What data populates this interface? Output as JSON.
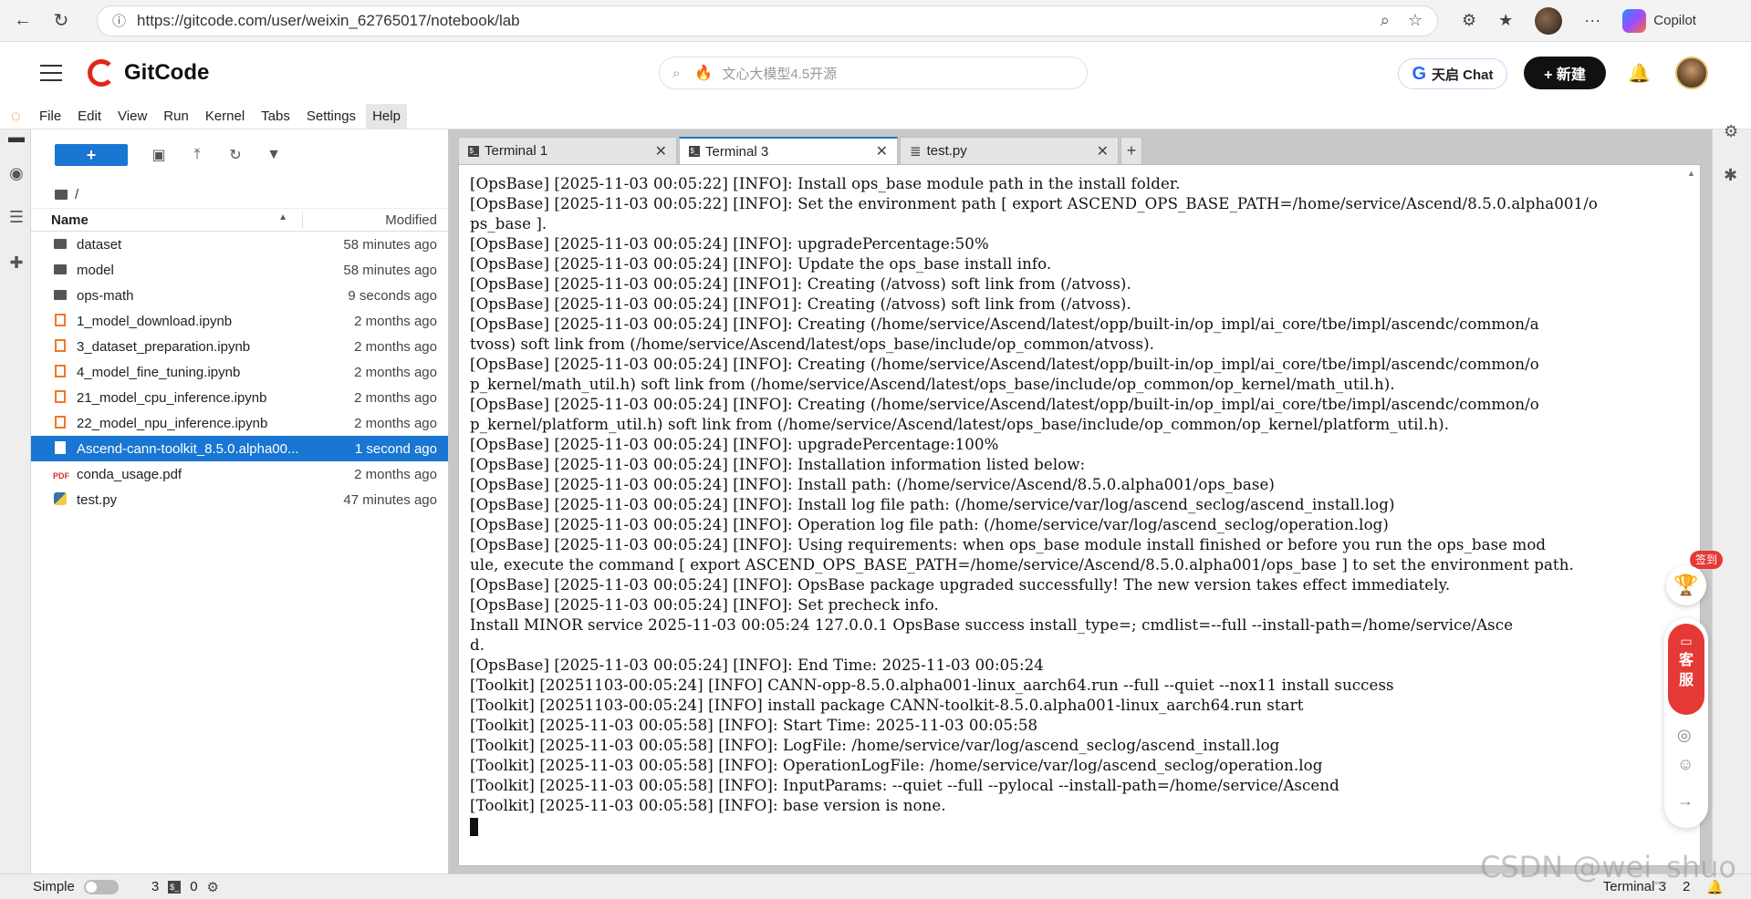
{
  "browser": {
    "url": "https://gitcode.com/user/weixin_62765017/notebook/lab",
    "copilot_label": "Copilot"
  },
  "gitcode": {
    "brand": "GitCode",
    "search_placeholder": "文心大模型4.5开源",
    "chat_label": "天启 Chat",
    "new_label": "+ 新建"
  },
  "menu": [
    "File",
    "Edit",
    "View",
    "Run",
    "Kernel",
    "Tabs",
    "Settings",
    "Help"
  ],
  "filebrowser": {
    "breadcrumb": "/",
    "col_name": "Name",
    "col_modified": "Modified",
    "files": [
      {
        "name": "dataset",
        "modified": "58 minutes ago"
      },
      {
        "name": "model",
        "modified": "58 minutes ago"
      },
      {
        "name": "ops-math",
        "modified": "9 seconds ago"
      },
      {
        "name": "1_model_download.ipynb",
        "modified": "2 months ago"
      },
      {
        "name": "3_dataset_preparation.ipynb",
        "modified": "2 months ago"
      },
      {
        "name": "4_model_fine_tuning.ipynb",
        "modified": "2 months ago"
      },
      {
        "name": "21_model_cpu_inference.ipynb",
        "modified": "2 months ago"
      },
      {
        "name": "22_model_npu_inference.ipynb",
        "modified": "2 months ago"
      },
      {
        "name": "Ascend-cann-toolkit_8.5.0.alpha00...",
        "modified": "1 second ago"
      },
      {
        "name": "conda_usage.pdf",
        "modified": "2 months ago"
      },
      {
        "name": "test.py",
        "modified": "47 minutes ago"
      }
    ]
  },
  "tabs": [
    {
      "label": "Terminal 1"
    },
    {
      "label": "Terminal 3"
    },
    {
      "label": "test.py"
    }
  ],
  "terminal": {
    "lines": [
      "[OpsBase] [2025-11-03 00:05:22] [INFO]: Install ops_base module path in the install folder.",
      "[OpsBase] [2025-11-03 00:05:22] [INFO]: Set the environment path [ export ASCEND_OPS_BASE_PATH=/home/service/Ascend/8.5.0.alpha001/o",
      "ps_base ].",
      "[OpsBase] [2025-11-03 00:05:24] [INFO]: upgradePercentage:50%",
      "[OpsBase] [2025-11-03 00:05:24] [INFO]: Update the ops_base install info.",
      "[OpsBase] [2025-11-03 00:05:24] [INFO1]: Creating (/atvoss) soft link from (/atvoss).",
      "[OpsBase] [2025-11-03 00:05:24] [INFO1]: Creating (/atvoss) soft link from (/atvoss).",
      "[OpsBase] [2025-11-03 00:05:24] [INFO]: Creating (/home/service/Ascend/latest/opp/built-in/op_impl/ai_core/tbe/impl/ascendc/common/a",
      "tvoss) soft link from (/home/service/Ascend/latest/ops_base/include/op_common/atvoss).",
      "[OpsBase] [2025-11-03 00:05:24] [INFO]: Creating (/home/service/Ascend/latest/opp/built-in/op_impl/ai_core/tbe/impl/ascendc/common/o",
      "p_kernel/math_util.h) soft link from (/home/service/Ascend/latest/ops_base/include/op_common/op_kernel/math_util.h).",
      "[OpsBase] [2025-11-03 00:05:24] [INFO]: Creating (/home/service/Ascend/latest/opp/built-in/op_impl/ai_core/tbe/impl/ascendc/common/o",
      "p_kernel/platform_util.h) soft link from (/home/service/Ascend/latest/ops_base/include/op_common/op_kernel/platform_util.h).",
      "[OpsBase] [2025-11-03 00:05:24] [INFO]: upgradePercentage:100%",
      "[OpsBase] [2025-11-03 00:05:24] [INFO]: Installation information listed below:",
      "[OpsBase] [2025-11-03 00:05:24] [INFO]: Install path: (/home/service/Ascend/8.5.0.alpha001/ops_base)",
      "[OpsBase] [2025-11-03 00:05:24] [INFO]: Install log file path: (/home/service/var/log/ascend_seclog/ascend_install.log)",
      "[OpsBase] [2025-11-03 00:05:24] [INFO]: Operation log file path: (/home/service/var/log/ascend_seclog/operation.log)",
      "[OpsBase] [2025-11-03 00:05:24] [INFO]: Using requirements: when ops_base module install finished or before you run the ops_base mod",
      "ule, execute the command [ export ASCEND_OPS_BASE_PATH=/home/service/Ascend/8.5.0.alpha001/ops_base ] to set the environment path.",
      "[OpsBase] [2025-11-03 00:05:24] [INFO]: OpsBase package upgraded successfully! The new version takes effect immediately.",
      "[OpsBase] [2025-11-03 00:05:24] [INFO]: Set precheck info.",
      "Install MINOR service 2025-11-03 00:05:24 127.0.0.1 OpsBase success install_type=; cmdlist=--full --install-path=/home/service/Asce",
      "d.",
      "[OpsBase] [2025-11-03 00:05:24] [INFO]: End Time: 2025-11-03 00:05:24",
      "[Toolkit] [20251103-00:05:24] [INFO] CANN-opp-8.5.0.alpha001-linux_aarch64.run --full --quiet --nox11 install success",
      "[Toolkit] [20251103-00:05:24] [INFO] install package CANN-toolkit-8.5.0.alpha001-linux_aarch64.run start",
      "[Toolkit] [2025-11-03 00:05:58] [INFO]: Start Time: 2025-11-03 00:05:58",
      "[Toolkit] [2025-11-03 00:05:58] [INFO]: LogFile: /home/service/var/log/ascend_seclog/ascend_install.log",
      "[Toolkit] [2025-11-03 00:05:58] [INFO]: OperationLogFile: /home/service/var/log/ascend_seclog/operation.log",
      "[Toolkit] [2025-11-03 00:05:58] [INFO]: InputParams: --quiet --full --pylocal --install-path=/home/service/Ascend",
      "[Toolkit] [2025-11-03 00:05:58] [INFO]: base version is none."
    ]
  },
  "widgets": {
    "signin_badge": "签到",
    "kefu_top": "客",
    "kefu_bottom": "服"
  },
  "statusbar": {
    "mode": "Simple",
    "count_a": "3",
    "count_b": "0",
    "active_tab": "Terminal 3",
    "notif_count": "2"
  },
  "watermark": "CSDN @wei_shuo"
}
